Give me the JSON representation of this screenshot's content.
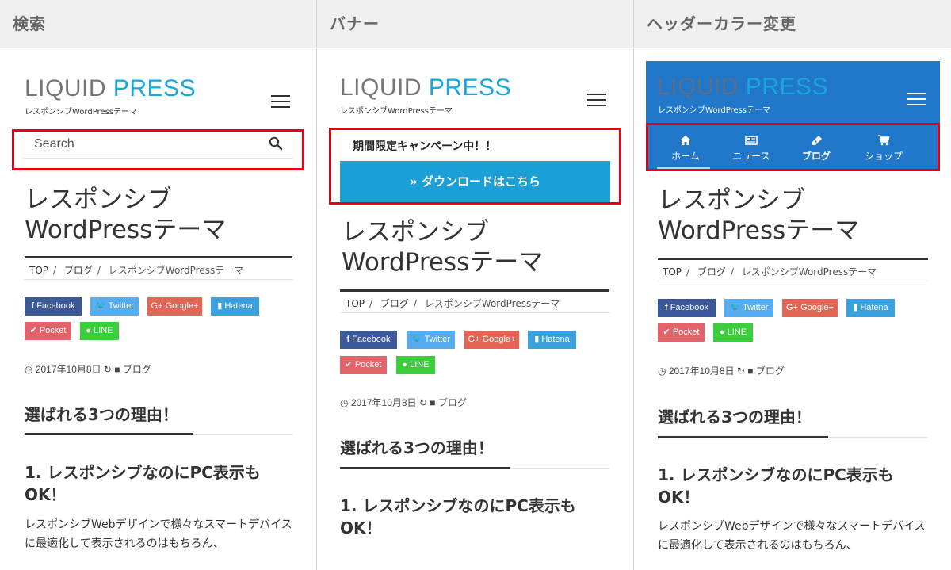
{
  "columns": [
    {
      "heading": "検索",
      "logo": {
        "part1": "LIQUID",
        "part2": "PRESS"
      },
      "tagline": "レスポンシブWordPressテーマ",
      "search": {
        "placeholder": "Search"
      },
      "post": {
        "title_line1": "レスポンシブ",
        "title_line2": "WordPressテーマ",
        "breadcrumb": [
          "TOP",
          "ブログ",
          "レスポンシブWordPressテーマ"
        ],
        "share": [
          "Facebook",
          "Twitter",
          "Google+",
          "Hatena",
          "Pocket",
          "LINE"
        ],
        "date": "2017年10月8日",
        "category": "ブログ",
        "h2": "選ばれる3つの理由！",
        "h3": "1. レスポンシブなのにPC表示もOK！",
        "paragraph": "レスポンシブWebデザインで様々なスマートデバイスに最適化して表示されるのはもちろん、"
      }
    },
    {
      "heading": "バナー",
      "logo": {
        "part1": "LIQUID",
        "part2": "PRESS"
      },
      "tagline": "レスポンシブWordPressテーマ",
      "banner": {
        "text": "期間限定キャンペーン中！！",
        "button": "» ダウンロードはこちら"
      },
      "post": {
        "title_line1": "レスポンシブ",
        "title_line2": "WordPressテーマ",
        "breadcrumb": [
          "TOP",
          "ブログ",
          "レスポンシブWordPressテーマ"
        ],
        "share": [
          "Facebook",
          "Twitter",
          "Google+",
          "Hatena",
          "Pocket",
          "LINE"
        ],
        "date": "2017年10月8日",
        "category": "ブログ",
        "h2": "選ばれる3つの理由！",
        "h3": "1. レスポンシブなのにPC表示もOK！"
      }
    },
    {
      "heading": "ヘッダーカラー変更",
      "logo": {
        "part1": "LIQUID",
        "part2": "PRESS"
      },
      "tagline": "レスポンシブWordPressテーマ",
      "nav": [
        "ホーム",
        "ニュース",
        "ブログ",
        "ショップ"
      ],
      "post": {
        "title_line1": "レスポンシブ",
        "title_line2": "WordPressテーマ",
        "breadcrumb": [
          "TOP",
          "ブログ",
          "レスポンシブWordPressテーマ"
        ],
        "share": [
          "Facebook",
          "Twitter",
          "Google+",
          "Hatena",
          "Pocket",
          "LINE"
        ],
        "date": "2017年10月8日",
        "category": "ブログ",
        "h2": "選ばれる3つの理由！",
        "h3": "1. レスポンシブなのにPC表示もOK！",
        "paragraph": "レスポンシブWebデザインで様々なスマートデバイスに最適化して表示されるのはもちろん、"
      }
    }
  ],
  "colors": {
    "brand": "#18a6dc",
    "header_blue": "#2177c9",
    "highlight": "#e60012",
    "facebook": "#3b5998",
    "twitter": "#55acee",
    "google": "#dd4b39",
    "hatena": "#3ba0dc",
    "pocket": "#e2636a",
    "line": "#3ccd3c"
  },
  "icons": {
    "search": "search-icon",
    "menu": "hamburger-icon",
    "clock": "clock-icon",
    "refresh": "refresh-icon",
    "folder": "folder-icon",
    "home": "home-icon",
    "news": "newspaper-icon",
    "blog": "pen-icon",
    "shop": "cart-icon"
  }
}
